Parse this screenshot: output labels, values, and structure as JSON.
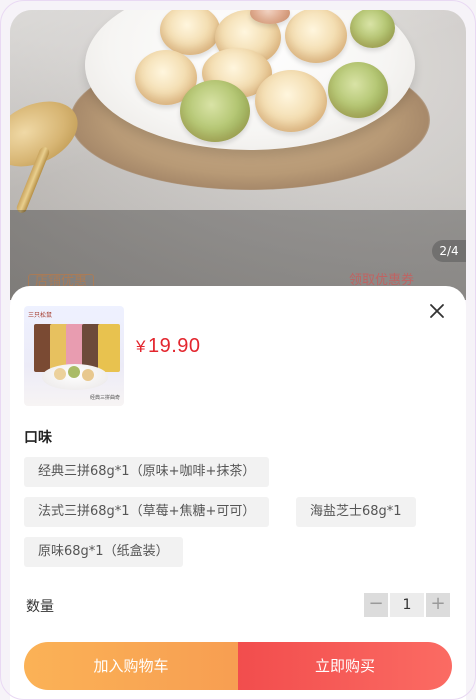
{
  "gallery": {
    "page_indicator": "2/4"
  },
  "behind": {
    "left_tag": "店铺优惠",
    "right_link": "领取优惠券"
  },
  "sheet": {
    "thumbnail_logo": "三只松鼠",
    "thumbnail_caption": "经典三拼曲奇",
    "currency": "¥",
    "price": "19.90",
    "option_title": "口味",
    "options": [
      "经典三拼68g*1（原味+咖啡+抹茶）",
      "法式三拼68g*1（草莓+焦糖+可可）",
      "海盐芝士68g*1",
      "原味68g*1（纸盒装）"
    ],
    "quantity_label": "数量",
    "quantity": "1",
    "minus": "−",
    "plus": "+",
    "add_to_cart": "加入购物车",
    "buy_now": "立即购买"
  },
  "colors": {
    "price": "#e3262e",
    "cart_button": "#f9a654",
    "buy_button": "#f55650"
  }
}
